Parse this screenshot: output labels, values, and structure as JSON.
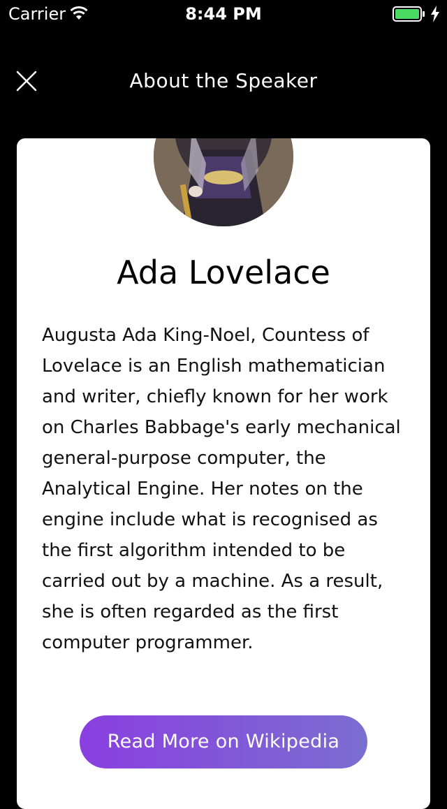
{
  "status_bar": {
    "carrier": "Carrier",
    "time": "8:44 PM",
    "battery_color": "#4cd964"
  },
  "nav": {
    "title": "About the Speaker",
    "close_icon": "close-icon"
  },
  "speaker": {
    "name": "Ada Lovelace",
    "bio": "Augusta Ada King-Noel, Countess of Lovelace is an English mathematician and writer, chiefly known for her work on Charles Babbage's early mechanical general-purpose computer, the Analytical Engine. Her notes on the engine include what is recognised as the first algorithm intended to be carried out by a machine. As a result, she is often regarded as the first computer programmer."
  },
  "actions": {
    "wiki_label": "Read More on Wikipedia"
  },
  "colors": {
    "background": "#000000",
    "card": "#ffffff",
    "button_gradient_start": "#8a3fe0",
    "button_gradient_end": "#7a6ed0"
  }
}
